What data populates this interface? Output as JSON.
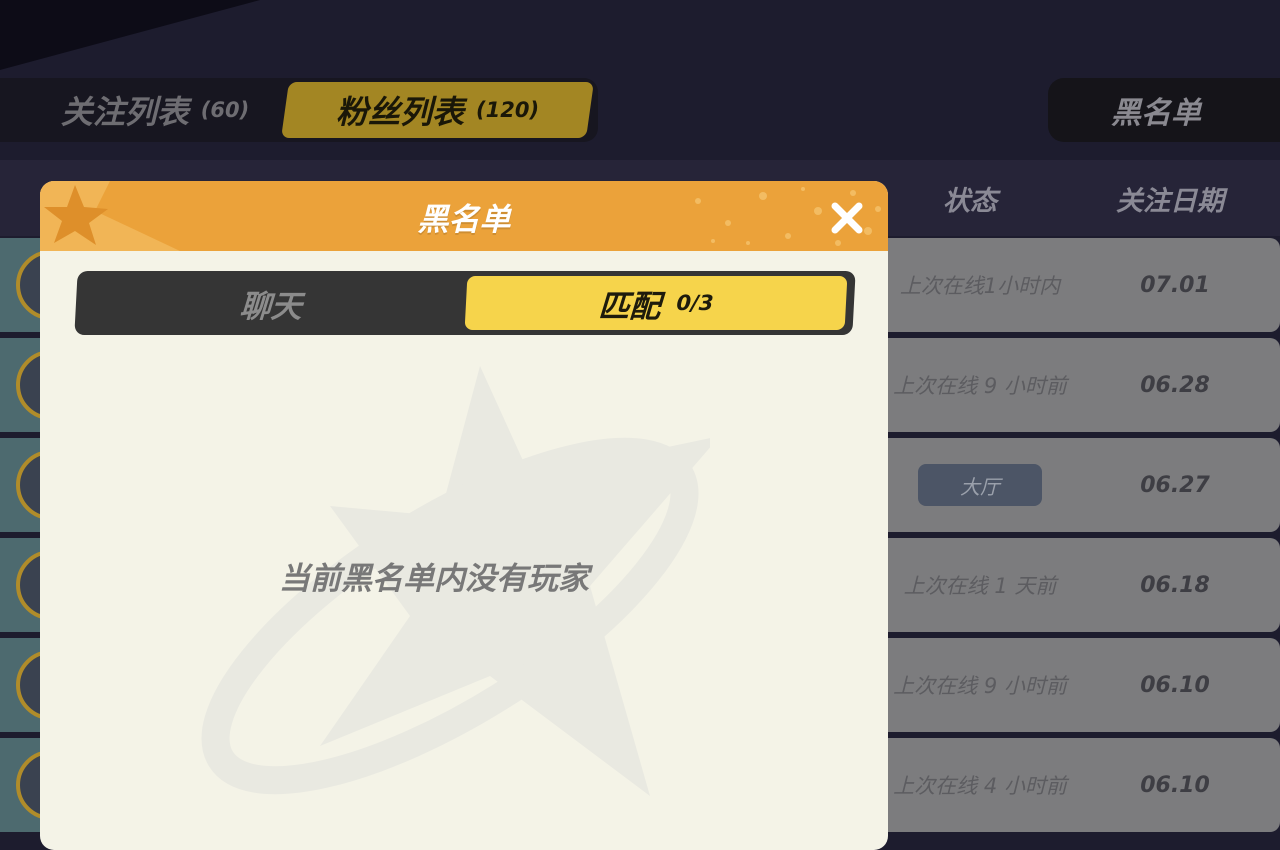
{
  "top_tabs": [
    {
      "label": "关注列表",
      "count": "(60)"
    },
    {
      "label": "粉丝列表",
      "count": "(120)"
    }
  ],
  "blacklist_button": "黑名单",
  "table": {
    "headers": {
      "status": "状态",
      "date": "关注日期"
    },
    "rows": [
      {
        "status": "上次在线1小时内",
        "date": "07.01"
      },
      {
        "status": "上次在线 9 小时前",
        "date": "06.28"
      },
      {
        "status": "大厅",
        "date": "06.27"
      },
      {
        "status": "上次在线 1 天前",
        "date": "06.18"
      },
      {
        "status": "上次在线 9 小时前",
        "date": "06.10"
      },
      {
        "status": "上次在线 4 小时前",
        "date": "06.10"
      }
    ]
  },
  "modal": {
    "title": "黑名单",
    "tabs": [
      {
        "label": "聊天"
      },
      {
        "label": "匹配",
        "count": "0/3"
      }
    ],
    "empty_message": "当前黑名单内没有玩家"
  },
  "colors": {
    "header_orange": "#eba23a",
    "active_tab_yellow": "#f6d44b",
    "modal_bg": "#f4f3e7",
    "page_bg": "#1d1c2e"
  }
}
